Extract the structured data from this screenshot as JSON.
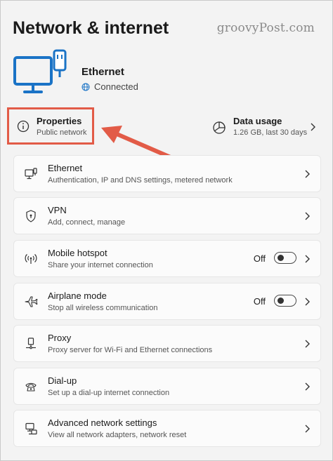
{
  "watermark": "groovyPost.com",
  "page_title": "Network & internet",
  "connection": {
    "name": "Ethernet",
    "status": "Connected"
  },
  "properties": {
    "title": "Properties",
    "subtitle": "Public network"
  },
  "data_usage": {
    "title": "Data usage",
    "subtitle": "1.26 GB, last 30 days"
  },
  "colors": {
    "accent_blue": "#1a73c6",
    "highlight_red": "#e25b47"
  },
  "settings": [
    {
      "title": "Ethernet",
      "subtitle": "Authentication, IP and DNS settings, metered network",
      "icon": "ethernet-icon"
    },
    {
      "title": "VPN",
      "subtitle": "Add, connect, manage",
      "icon": "shield-icon"
    },
    {
      "title": "Mobile hotspot",
      "subtitle": "Share your internet connection",
      "icon": "hotspot-icon",
      "toggle_label": "Off"
    },
    {
      "title": "Airplane mode",
      "subtitle": "Stop all wireless communication",
      "icon": "airplane-icon",
      "toggle_label": "Off"
    },
    {
      "title": "Proxy",
      "subtitle": "Proxy server for Wi-Fi and Ethernet connections",
      "icon": "proxy-icon"
    },
    {
      "title": "Dial-up",
      "subtitle": "Set up a dial-up internet connection",
      "icon": "dialup-icon"
    },
    {
      "title": "Advanced network settings",
      "subtitle": "View all network adapters, network reset",
      "icon": "advanced-network-icon"
    }
  ]
}
